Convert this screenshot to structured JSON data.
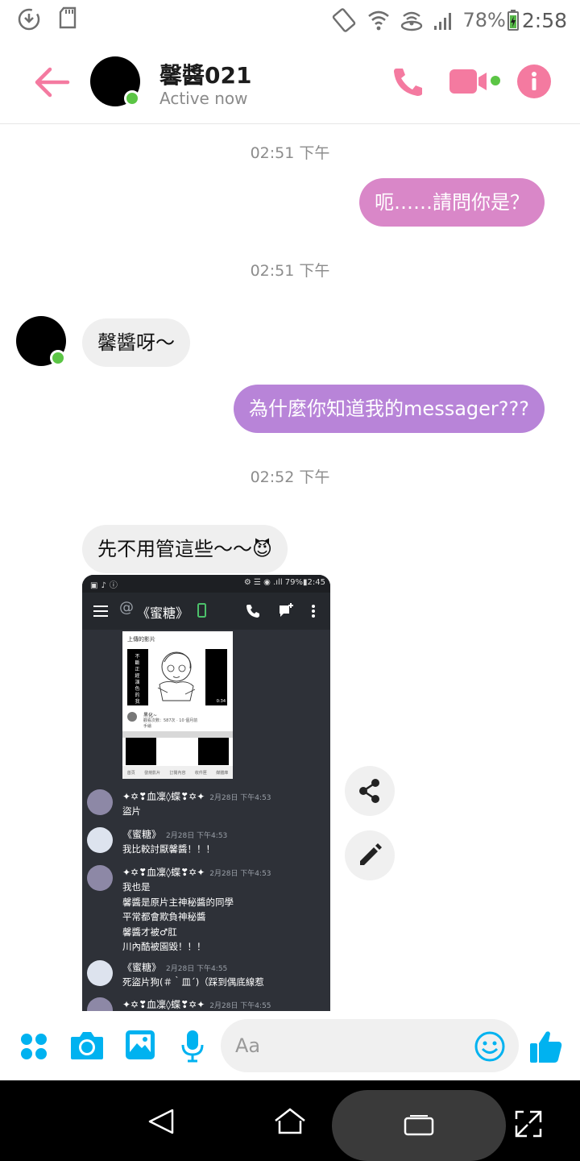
{
  "status_bar": {
    "battery": "78%",
    "time": "2:58",
    "icons": [
      "sync-icon",
      "sd-card-icon",
      "rotation-lock-icon",
      "wifi-icon",
      "hotspot-icon",
      "signal-icon",
      "battery-charging-icon"
    ]
  },
  "header": {
    "contact_name": "馨醬021",
    "contact_status": "Active now",
    "accent_color": "#f47aa0",
    "online_color": "#5bc545"
  },
  "messages": [
    {
      "type": "timestamp",
      "text": "02:51 下午"
    },
    {
      "type": "outgoing",
      "text": "呃……請問你是？"
    },
    {
      "type": "timestamp",
      "text": "02:51 下午"
    },
    {
      "type": "incoming",
      "text": "馨醬呀～"
    },
    {
      "type": "outgoing",
      "text": "為什麼你知道我的messager???"
    },
    {
      "type": "timestamp",
      "text": "02:52 下午"
    },
    {
      "type": "incoming",
      "text": "先不用管這些～～😈"
    }
  ],
  "shared_image": {
    "status_battery": "79%",
    "status_time": "2:45",
    "chat_title": "《蜜糖》",
    "card_title": "上傳的影片",
    "card_vertical_text": "不斷正經演色的我",
    "card_duration": "0:34",
    "card_channel": "黑化~",
    "card_views": "觀看次數：587次 · 10 個月前",
    "card_tag": "手繪",
    "card_nav": [
      "首頁",
      "發燒影片",
      "訂閱內容",
      "收件匣",
      "媒體庫"
    ],
    "comments": [
      {
        "name": "✦✡❣血凜◊蝶❣✡✦",
        "date": "2月28日 下午4:53",
        "lines": [
          "盜片"
        ]
      },
      {
        "name": "《蜜糖》",
        "date": "2月28日 下午4:53",
        "lines": [
          "我比較討厭馨醬！！！"
        ]
      },
      {
        "name": "✦✡❣血凜◊蝶❣✡✦",
        "date": "2月28日 下午4:53",
        "lines": [
          "我也是",
          "馨醬是原片主神秘醬的同學",
          "平常都會欺負神秘醬",
          "馨醬才被♂肛",
          "川內酷被園毀！！！"
        ]
      },
      {
        "name": "《蜜糖》",
        "date": "2月28日 下午4:55",
        "lines": [
          "死盜片狗(＃｀皿´)（踩到偶底線惹"
        ]
      },
      {
        "name": "✦✡❣血凜◊蝶❣✡✦",
        "date": "2月28日 下午4:55",
        "lines": []
      }
    ]
  },
  "composer": {
    "placeholder": "Aa",
    "icons": [
      "more-icon",
      "camera-icon",
      "gallery-icon",
      "mic-icon",
      "emoji-icon",
      "thumbs-up-icon"
    ],
    "accent_color": "#00b2f0"
  }
}
